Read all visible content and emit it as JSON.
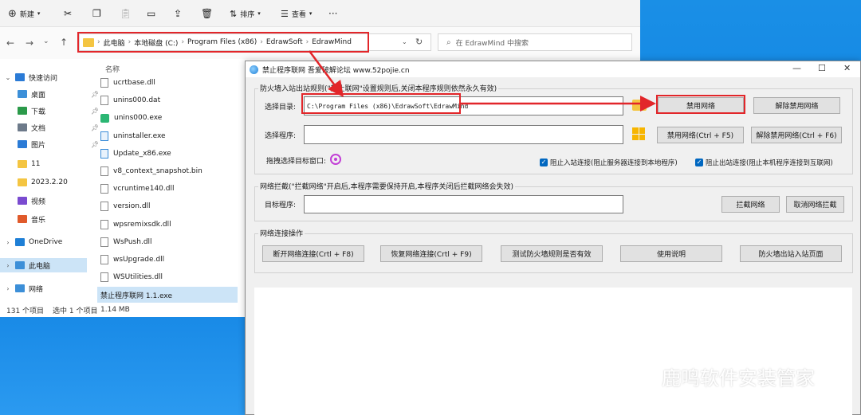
{
  "explorer": {
    "toolbar": {
      "new": "新建",
      "sort": "排序",
      "view": "查看"
    },
    "breadcrumb": [
      "此电脑",
      "本地磁盘 (C:)",
      "Program Files (x86)",
      "EdrawSoft",
      "EdrawMind"
    ],
    "search_placeholder": "在 EdrawMind 中搜索",
    "nav": [
      {
        "label": "快速访问",
        "chev": "⌄",
        "color": "#2b7bd6"
      },
      {
        "label": "桌面",
        "pinned": true,
        "color": "#3c8fd8"
      },
      {
        "label": "下载",
        "pinned": true,
        "color": "#2b9a4a"
      },
      {
        "label": "文档",
        "pinned": true,
        "color": "#6d7a8a"
      },
      {
        "label": "图片",
        "pinned": true,
        "color": "#2b7bd6"
      },
      {
        "label": "11",
        "color": "#f4c542"
      },
      {
        "label": "2023.2.20",
        "color": "#f4c542"
      },
      {
        "label": "视频",
        "color": "#7a4bd0"
      },
      {
        "label": "音乐",
        "color": "#e05a2b"
      },
      {
        "label": "OneDrive",
        "chev": "›",
        "color": "#1e7fd6"
      },
      {
        "label": "此电脑",
        "chev": "›",
        "color": "#3c8fd8",
        "selected": true
      },
      {
        "label": "网络",
        "chev": "›",
        "color": "#3c8fd8"
      }
    ],
    "column_name": "名称",
    "files": [
      {
        "name": "ucrtbase.dll",
        "kind": "file"
      },
      {
        "name": "unins000.dat",
        "kind": "file"
      },
      {
        "name": "unins000.exe",
        "kind": "green"
      },
      {
        "name": "uninstaller.exe",
        "kind": "exe"
      },
      {
        "name": "Update_x86.exe",
        "kind": "exe"
      },
      {
        "name": "v8_context_snapshot.bin",
        "kind": "file"
      },
      {
        "name": "vcruntime140.dll",
        "kind": "file"
      },
      {
        "name": "version.dll",
        "kind": "file"
      },
      {
        "name": "wpsremixsdk.dll",
        "kind": "file"
      },
      {
        "name": "WsPush.dll",
        "kind": "file"
      },
      {
        "name": "wsUpgrade.dll",
        "kind": "file"
      },
      {
        "name": "WSUtilities.dll",
        "kind": "file"
      },
      {
        "name": "禁止程序联网 1.1.exe",
        "kind": "app",
        "selected": true
      }
    ],
    "status": {
      "count": "131 个项目",
      "selected": "选中 1 个项目",
      "size": "1.14 MB"
    }
  },
  "app": {
    "title": "禁止程序联网 吾爱破解论坛 www.52pojie.cn",
    "win_controls": {
      "minimize": "—",
      "maximize": "☐",
      "close": "✕"
    },
    "firewall": {
      "group_label": "防火墙入站出站规则(\"禁止联网\"设置规则后,关闭本程序规则依然永久有效)",
      "dir_label": "选择目录:",
      "dir_value": "C:\\Program Files (x86)\\EdrawSoft\\EdrawMind",
      "prog_label": "选择程序:",
      "prog_value": "",
      "btn_block": "禁用网络",
      "btn_unblock": "解除禁用网络",
      "btn_block_key": "禁用网络(Ctrl + F5)",
      "btn_unblock_key": "解除禁用网络(Ctrl + F6)",
      "drag_label": "拖拽选择目标窗口:",
      "chk_inbound": "阻止入站连接(阻止服务器连接到本地程序)",
      "chk_outbound": "阻止出站连接(阻止本机程序连接到互联网)"
    },
    "intercept": {
      "group_label": "网络拦截(\"拦截网络\"开启后,本程序需要保持开启,本程序关闭后拦截网络会失效)",
      "target_label": "目标程序:",
      "target_value": "",
      "btn_intercept": "拦截网络",
      "btn_cancel": "取消网络拦截"
    },
    "connection": {
      "group_label": "网络连接操作",
      "btn_disconnect": "断开网络连接(Crtl + F8)",
      "btn_restore": "恢复网络连接(Crtl + F9)",
      "btn_test": "测试防火墙规则是否有效",
      "btn_help": "使用说明",
      "btn_firewall_page": "防火墙出站入站页面"
    }
  },
  "watermark_text": "鹿鸣软件安装管家",
  "colors": {
    "highlight": "#e2262a",
    "accent": "#0067c0"
  }
}
